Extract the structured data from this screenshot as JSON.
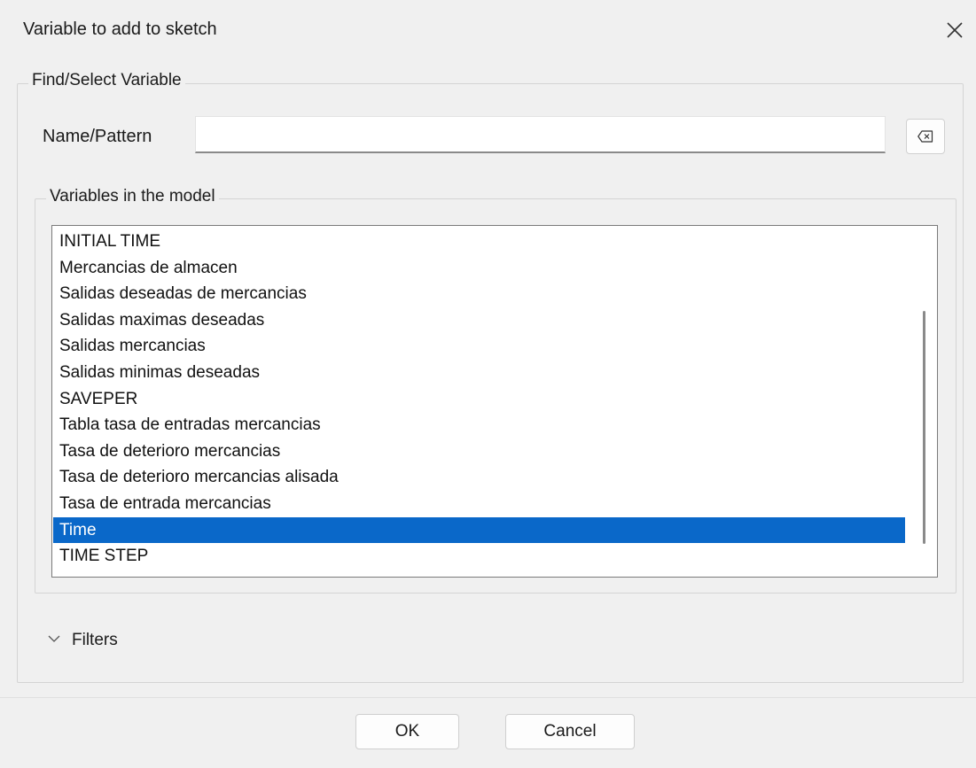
{
  "window": {
    "title": "Variable to add to sketch",
    "close_icon": "close-icon"
  },
  "find_group": {
    "legend": "Find/Select Variable",
    "name_label": "Name/Pattern",
    "name_value": "",
    "name_placeholder": "",
    "clear_icon": "backspace-clear-icon"
  },
  "variables_group": {
    "legend": "Variables in the model",
    "items": [
      "INITIAL TIME",
      "Mercancias de almacen",
      "Salidas deseadas de mercancias",
      "Salidas maximas deseadas",
      "Salidas mercancias",
      "Salidas minimas deseadas",
      "SAVEPER",
      "Tabla tasa de entradas mercancias",
      "Tasa de deterioro mercancias",
      "Tasa de deterioro mercancias alisada",
      "Tasa de entrada mercancias",
      "Time",
      "TIME STEP"
    ],
    "selected": "Time"
  },
  "filters": {
    "label": "Filters",
    "icon": "chevron-down-icon"
  },
  "buttons": {
    "ok": "OK",
    "cancel": "Cancel"
  },
  "colors": {
    "selection": "#0a68c9",
    "background": "#f0f0f0"
  }
}
